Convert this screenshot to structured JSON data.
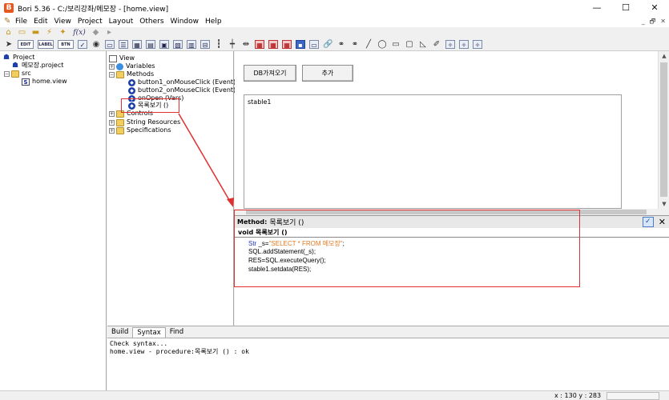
{
  "window": {
    "title": "Bori 5.36 - C:/보리강좌/메모장 - [home.view]",
    "minimize": "—",
    "maximize": "☐",
    "close": "✕"
  },
  "menu": {
    "items": [
      "File",
      "Edit",
      "View",
      "Project",
      "Layout",
      "Others",
      "Window",
      "Help"
    ],
    "mdi_min": "_",
    "mdi_restore": "🗗",
    "mdi_close": "✕"
  },
  "toolbar": {
    "fx_label": "f(x)",
    "edit_label": "EDIT",
    "label_label": "LABEL",
    "btn_label": "BTN"
  },
  "project_tree": {
    "root": "Project",
    "project_file": "메모장.project",
    "src_folder": "src",
    "view_file": "home.view"
  },
  "outline_tree": {
    "view": "View",
    "variables": "Variables",
    "methods": "Methods",
    "method_items": [
      "button1_onMouseClick (Event)",
      "button2_onMouseClick (Event)",
      "onOpen (Vars)",
      "목록보기 ()"
    ],
    "controls": "Controls",
    "string_resources": "String Resources",
    "specifications": "Specifications"
  },
  "design": {
    "button1": "DB가져오기",
    "button2": "추가",
    "table_label": "stable1"
  },
  "method_panel": {
    "header_title": "Method:",
    "header_name": "목록보기 ()",
    "signature": "void 목록보기 ()",
    "code": {
      "line1_type": "Str",
      "line1_var": " _s=",
      "line1_string": "\"SELECT * FROM 메모장\"",
      "line1_end": ";",
      "line2": "SQL.addStatement(_s);",
      "line3": "RES=SQL.executeQuery();",
      "line4": "stable1.setdata(RES);"
    }
  },
  "output": {
    "tabs": [
      "Build",
      "Syntax",
      "Find"
    ],
    "active_tab": "Syntax",
    "lines": [
      "Check syntax...",
      "home.view - procedure:목록보기 () : ok"
    ]
  },
  "status": {
    "coords": "x : 130  y : 283"
  },
  "colors": {
    "highlight": "#e03030",
    "keyword": "#1a32c8",
    "string_literal": "#e07a20"
  }
}
